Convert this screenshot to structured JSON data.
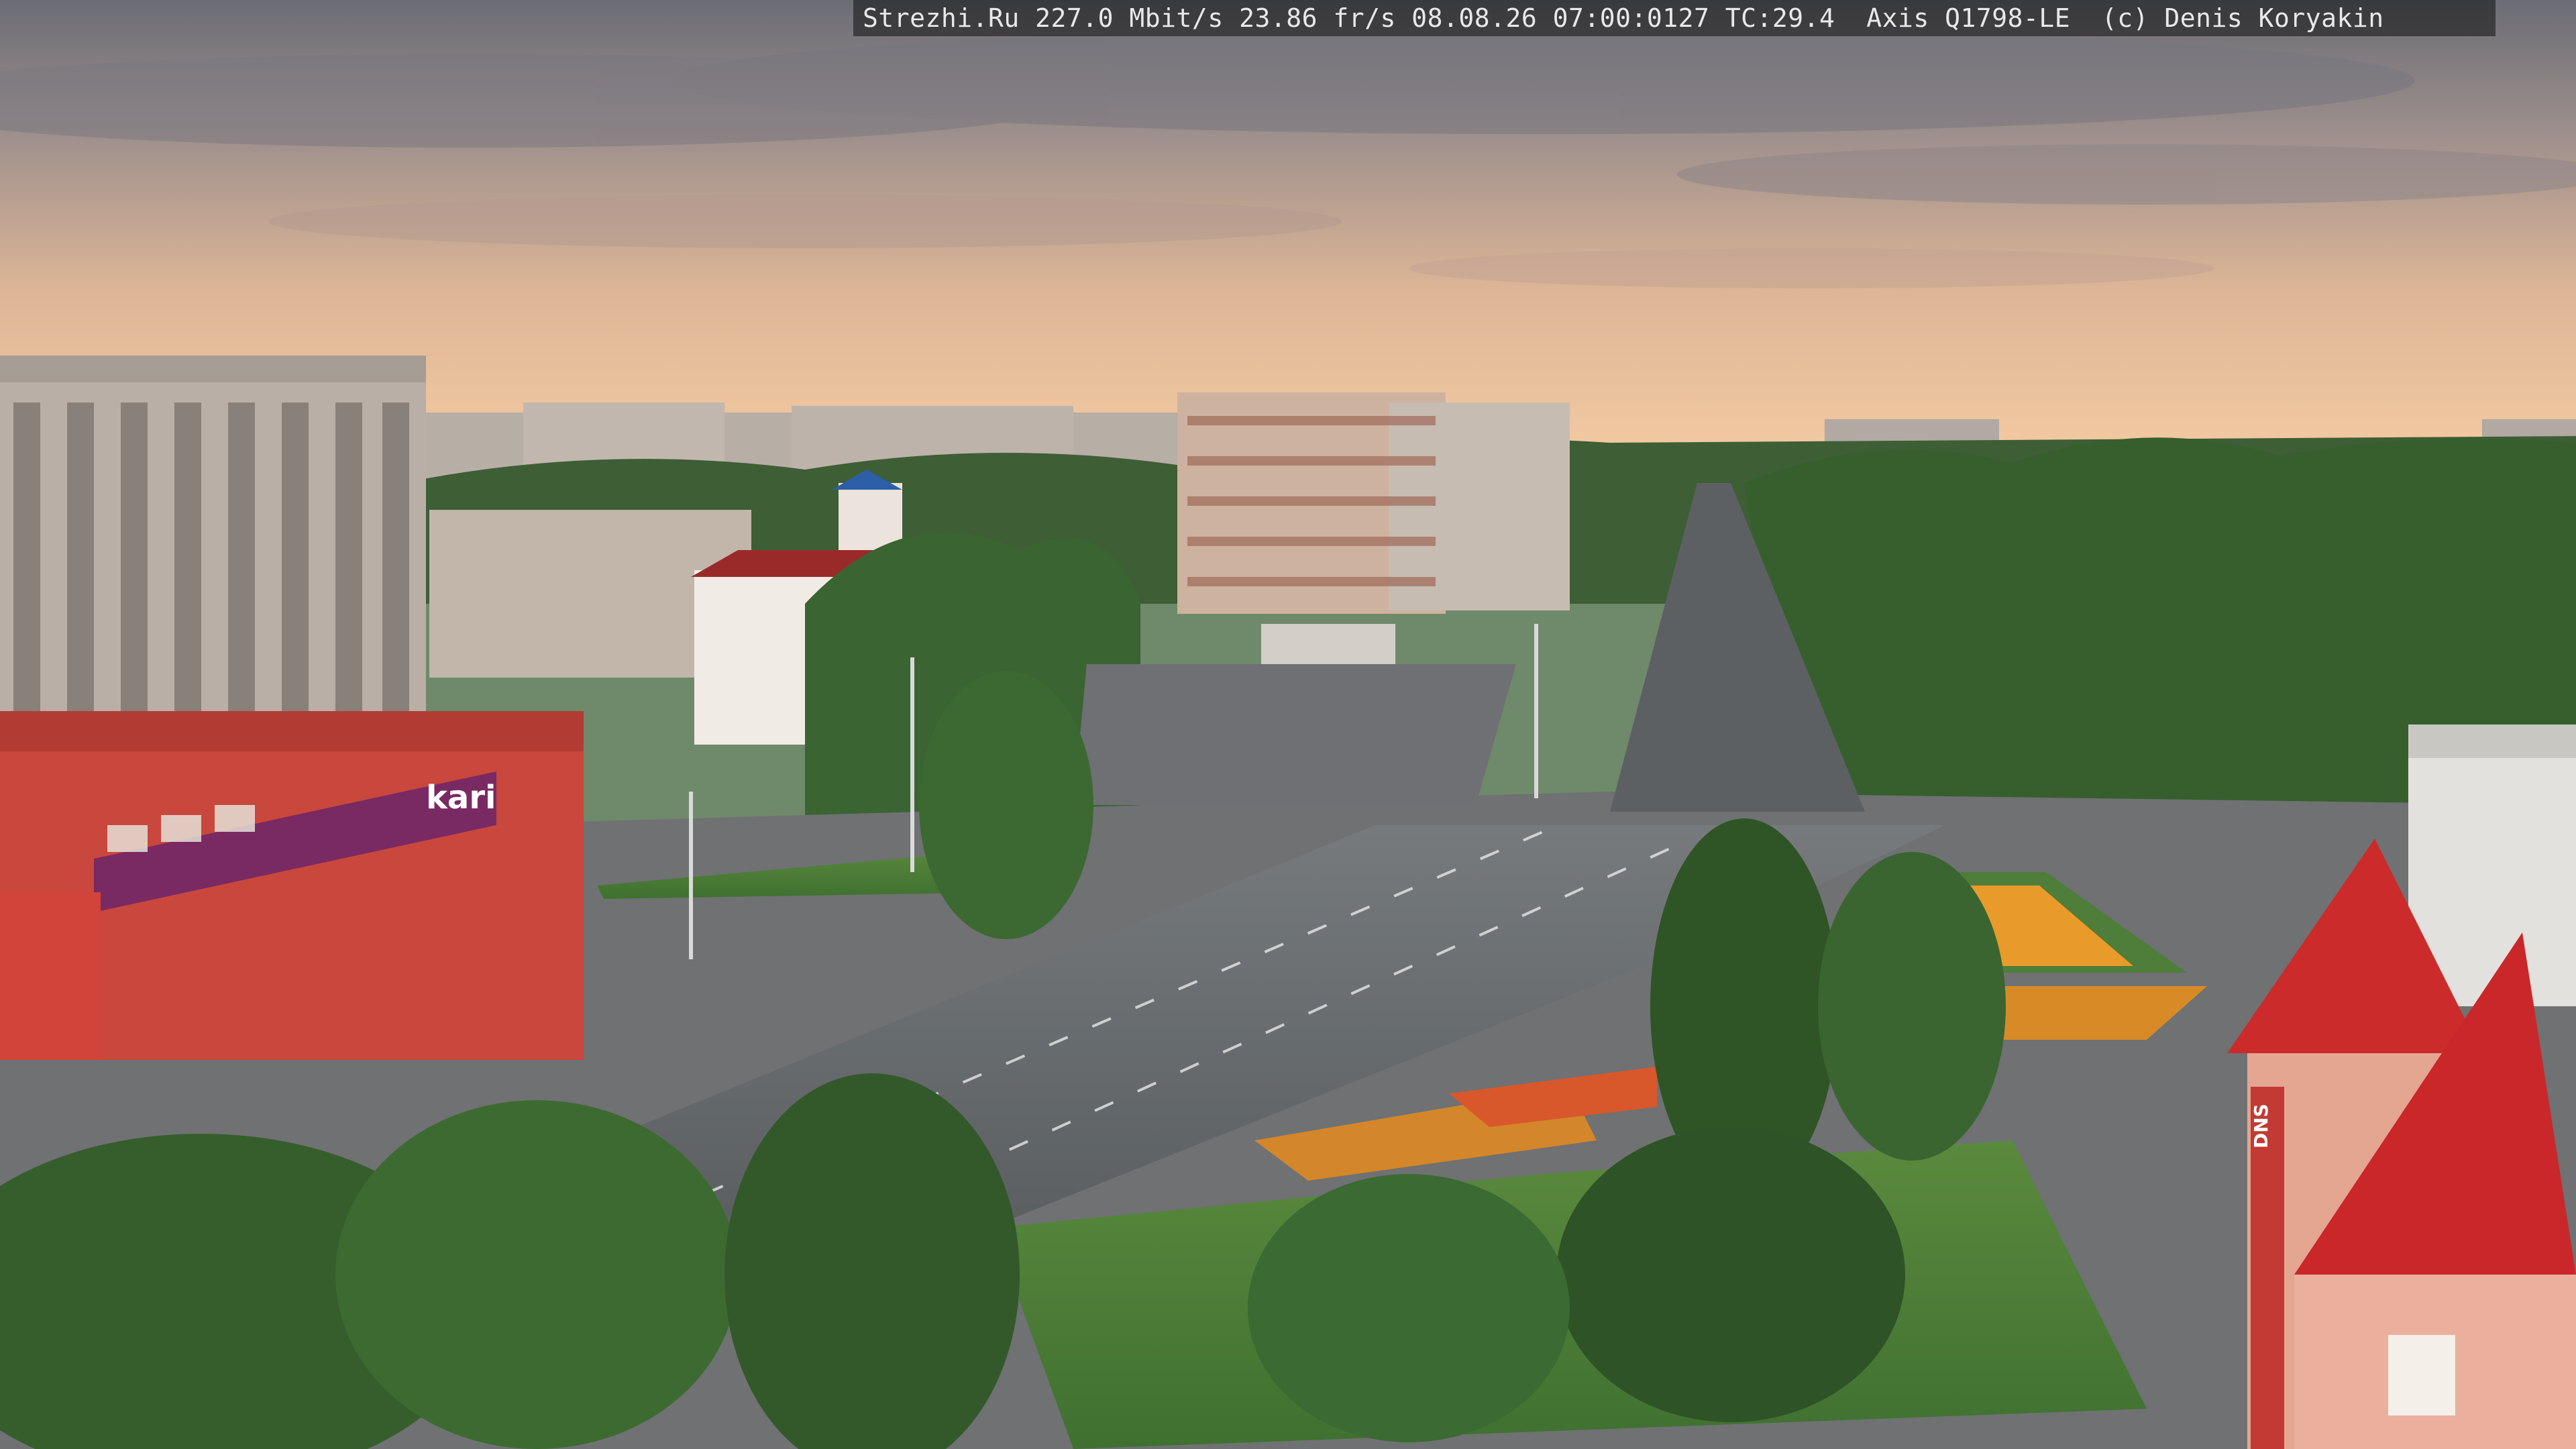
{
  "camera_overlay": {
    "text": "Strezhi.Ru 227.0 Mbit/s 23.86 fr/s 08.08.26 07:00:0127 TC:29.4  Axis Q1798-LE  (c) Denis Koryakin"
  },
  "scene": {
    "description_labels": {
      "store_sign": "kari",
      "tower_sign": "DNS"
    },
    "colors": {
      "sky_top": "#6e7078",
      "sky_mid": "#c9a98e",
      "sky_horizon": "#f3c9a0",
      "trees": "#3f6b33",
      "road": "#5f6265",
      "store_red": "#c9473c",
      "store_purple": "#7a2a63",
      "roof_red": "#cc2b2b"
    }
  }
}
